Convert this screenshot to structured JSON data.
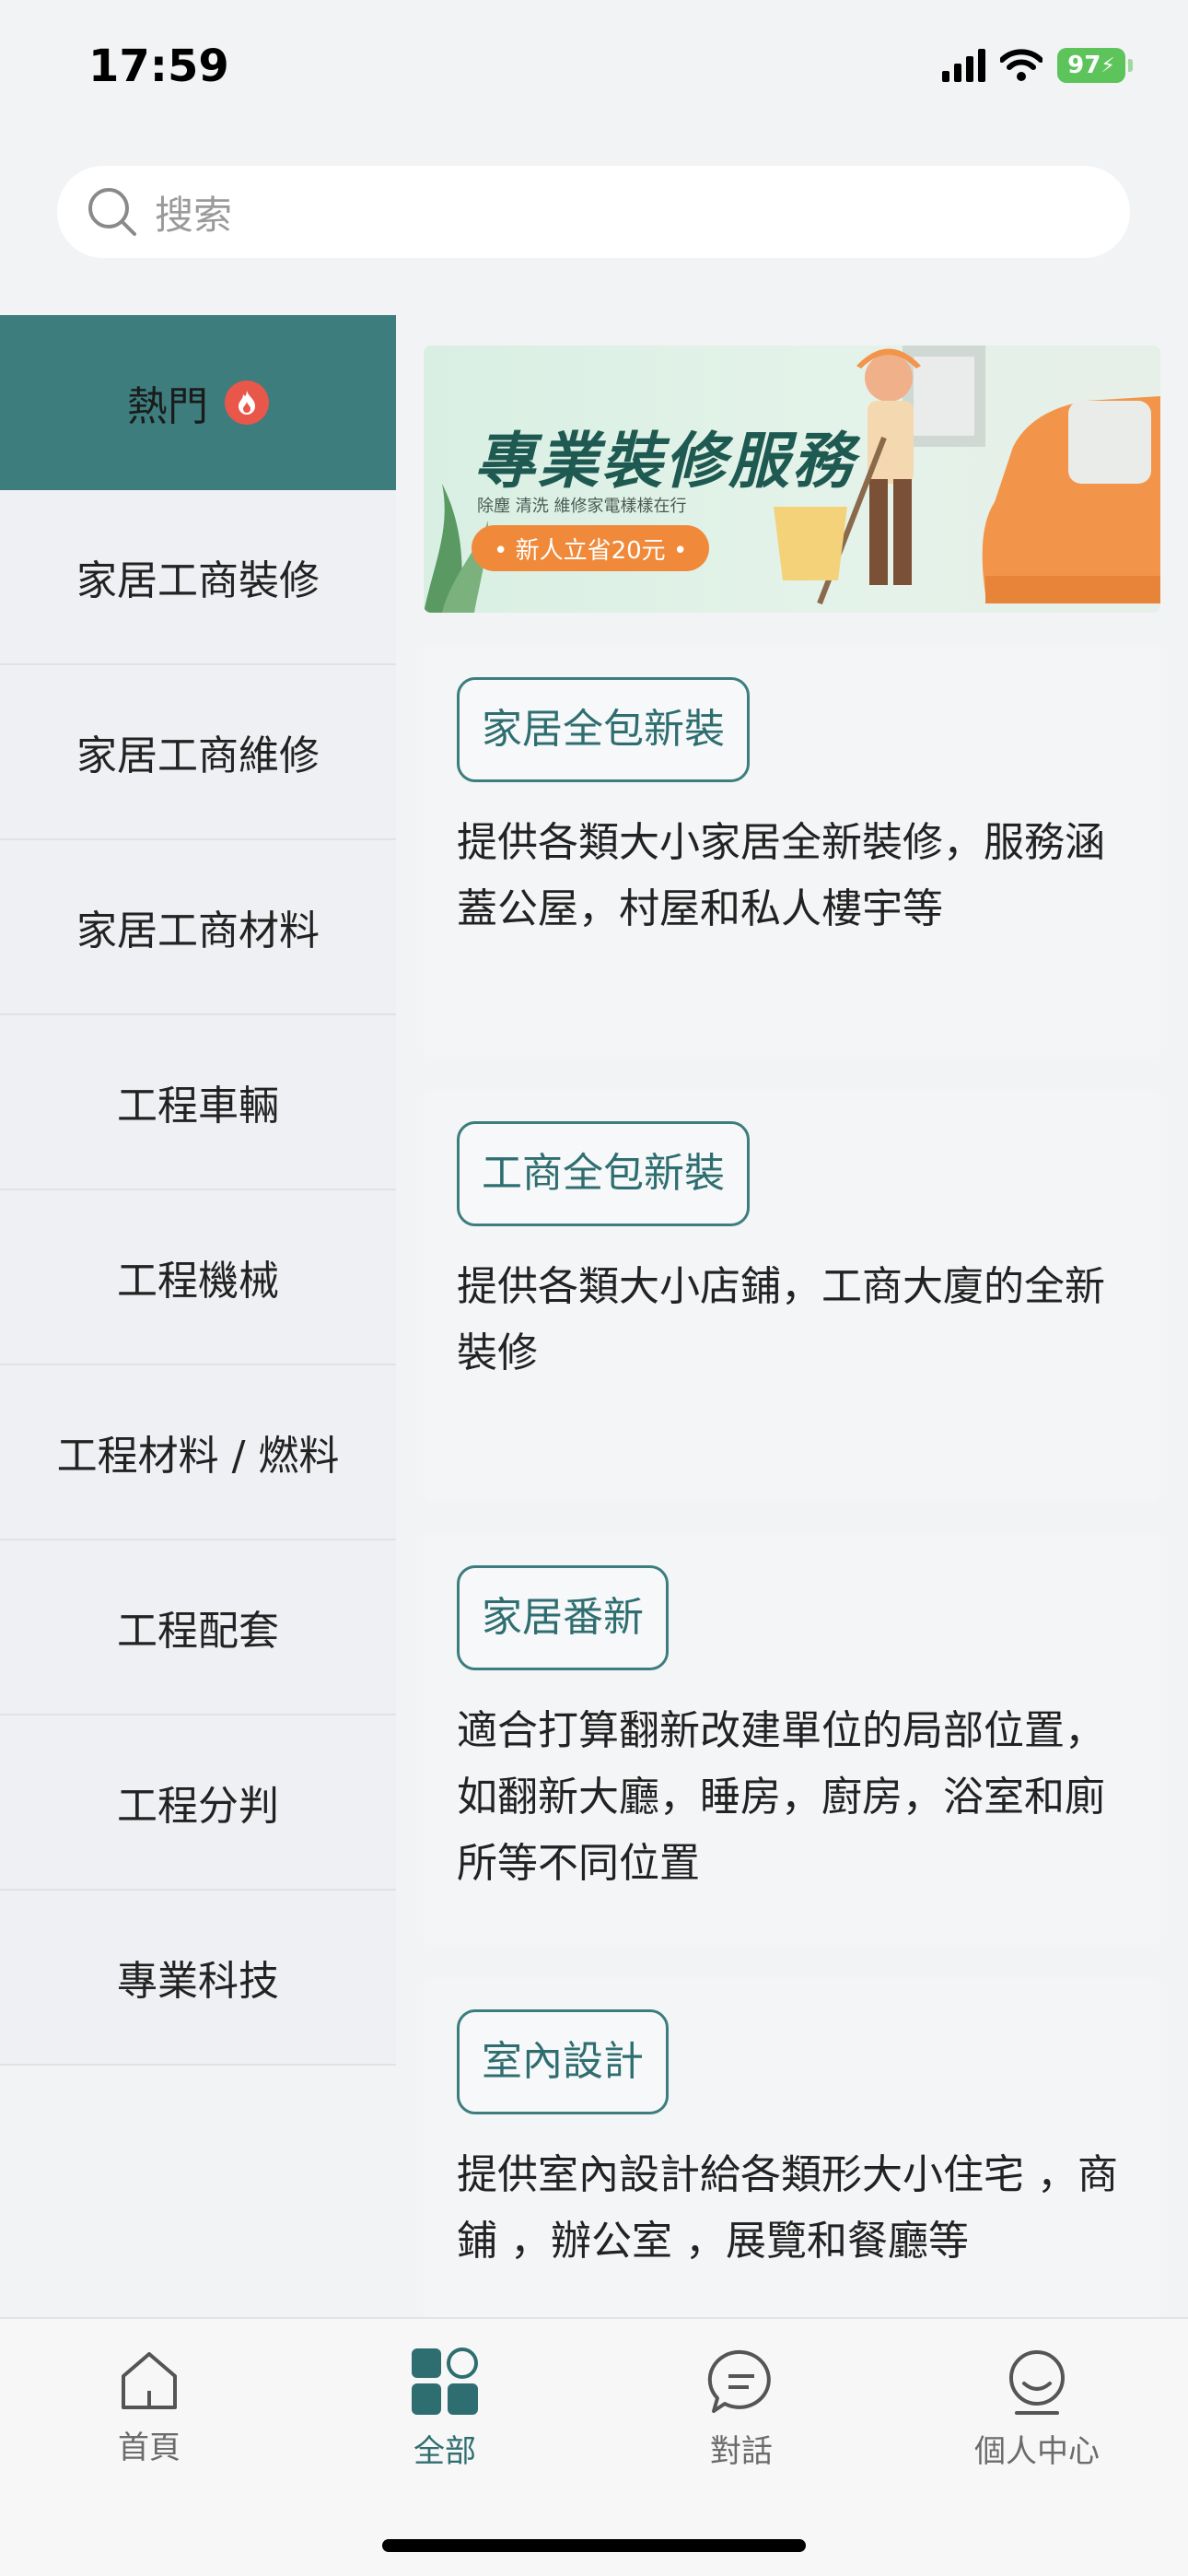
{
  "status_bar": {
    "time": "17:59",
    "battery": "97"
  },
  "search": {
    "placeholder": "搜索"
  },
  "sidebar": {
    "items": [
      {
        "label": "熱門"
      },
      {
        "label": "家居工商裝修"
      },
      {
        "label": "家居工商維修"
      },
      {
        "label": "家居工商材料"
      },
      {
        "label": "工程車輛"
      },
      {
        "label": "工程機械"
      },
      {
        "label": "工程材料 / 燃料"
      },
      {
        "label": "工程配套"
      },
      {
        "label": "工程分判"
      },
      {
        "label": "專業科技"
      }
    ]
  },
  "banner": {
    "title": "專業裝修服務",
    "subtitle": "除塵  清洗  維修家電樣樣在行",
    "promo": "• 新人立省20元 •"
  },
  "cards": [
    {
      "tag": "家居全包新裝",
      "desc": "提供各類大小家居全新裝修，服務涵蓋公屋，村屋和私人樓宇等"
    },
    {
      "tag": "工商全包新裝",
      "desc": "提供各類大小店鋪，工商大廈的全新裝修"
    },
    {
      "tag": "家居番新",
      "desc": "適合打算翻新改建單位的局部位置，如翻新大廳，睡房，廚房，浴室和廁所等不同位置"
    },
    {
      "tag": "室內設計",
      "desc": "提供室內設計給各類形大小住宅 ，商鋪 ，辦公室 ，展覽和餐廳等"
    }
  ],
  "tab_bar": {
    "tabs": [
      {
        "label": "首頁",
        "icon": "home-icon"
      },
      {
        "label": "全部",
        "icon": "grid-icon"
      },
      {
        "label": "對話",
        "icon": "chat-icon"
      },
      {
        "label": "個人中心",
        "icon": "profile-icon"
      }
    ]
  },
  "colors": {
    "accent": "#3d7d7e",
    "promo": "#f08a3a",
    "hot": "#e8574a"
  }
}
